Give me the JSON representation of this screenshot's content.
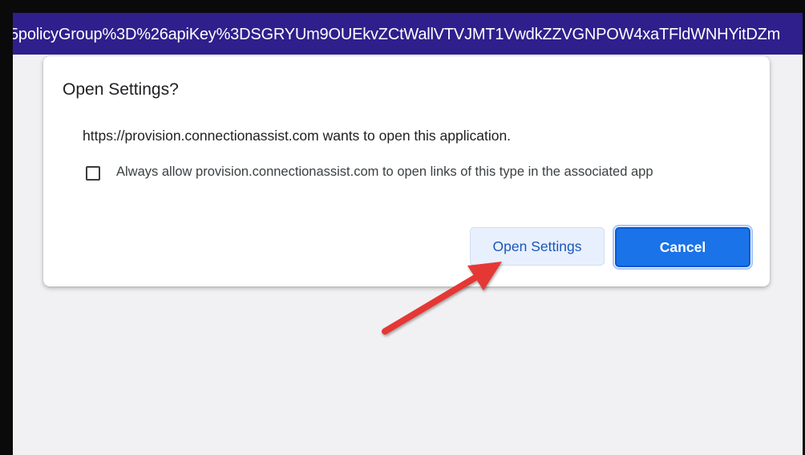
{
  "browser": {
    "url_fragment": "5policyGroup%3D%26apiKey%3DSGRYUm9OUEkvZCtWallVTVJMT1VwdkZZVGNPOW4xaTFldWNHYitDZm"
  },
  "dialog": {
    "title": "Open Settings?",
    "message": "https://provision.connectionassist.com wants to open this application.",
    "checkbox_label": "Always allow provision.connectionassist.com to open links of this type in the associated app",
    "checkbox_checked": false,
    "open_button_label": "Open Settings",
    "cancel_button_label": "Cancel"
  },
  "colors": {
    "url_bar_bg": "#2e1f8c",
    "primary_button": "#1a73e8",
    "secondary_button_bg": "#e8f0fe",
    "annotation_arrow": "#e53935"
  }
}
